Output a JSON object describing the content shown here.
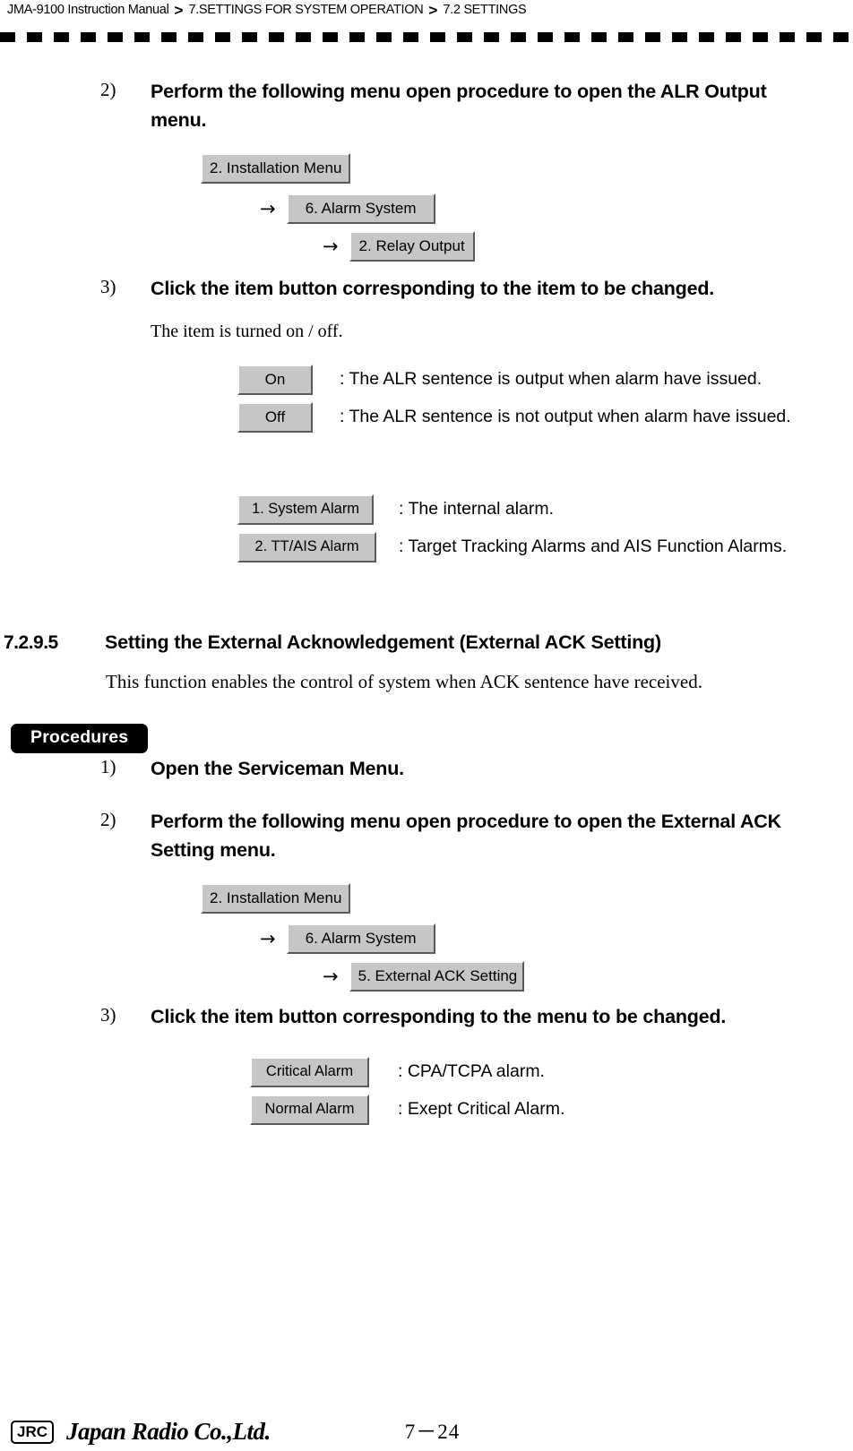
{
  "header": {
    "manual": "JMA-9100 Instruction Manual",
    "separator": ">",
    "chapter": "7.SETTINGS FOR SYSTEM OPERATION",
    "section": "7.2  SETTINGS"
  },
  "relay_output": {
    "step2_num": "2)",
    "step2_text": "Perform the following menu open procedure to open the ALR Output menu.",
    "menu_path": [
      {
        "label": "2. Installation Menu",
        "arrow": ""
      },
      {
        "label": "6. Alarm System",
        "arrow": "→"
      },
      {
        "label": "2. Relay Output",
        "arrow": "→"
      }
    ],
    "step3_num": "3)",
    "step3_text": "Click the item button corresponding to the item to be changed.",
    "note": "The item is turned on / off.",
    "options": [
      {
        "button": "On",
        "desc": ": The ALR sentence is output when alarm have issued."
      },
      {
        "button": "Off",
        "desc": ": The ALR sentence is not output when alarm have issued."
      }
    ],
    "alarm_types": [
      {
        "button": "1. System Alarm",
        "desc": ": The internal alarm."
      },
      {
        "button": "2. TT/AIS Alarm",
        "desc": ": Target Tracking Alarms and AIS Function Alarms."
      }
    ]
  },
  "external_ack": {
    "section_number": "7.2.9.5",
    "section_title": "Setting the External Acknowledgement (External ACK Setting)",
    "intro": "This function enables the control of system when ACK sentence have received.",
    "procedures_label": "Procedures",
    "step1_num": "1)",
    "step1_text": "Open the Serviceman Menu.",
    "step2_num": "2)",
    "step2_text": "Perform the following menu open procedure to open the External ACK Setting menu.",
    "menu_path": [
      {
        "label": "2. Installation Menu",
        "arrow": ""
      },
      {
        "label": "6. Alarm System",
        "arrow": "→"
      },
      {
        "label": "5. External ACK Setting",
        "arrow": "→"
      }
    ],
    "step3_num": "3)",
    "step3_text": "Click the item button corresponding to the menu to be changed.",
    "options": [
      {
        "button": "Critical Alarm",
        "desc": ":  CPA/TCPA alarm."
      },
      {
        "button": "Normal Alarm",
        "desc": ":  Exept Critical Alarm."
      }
    ]
  },
  "footer": {
    "logo": "JRC",
    "company": "Japan Radio Co.,Ltd.",
    "page": "7－24"
  }
}
